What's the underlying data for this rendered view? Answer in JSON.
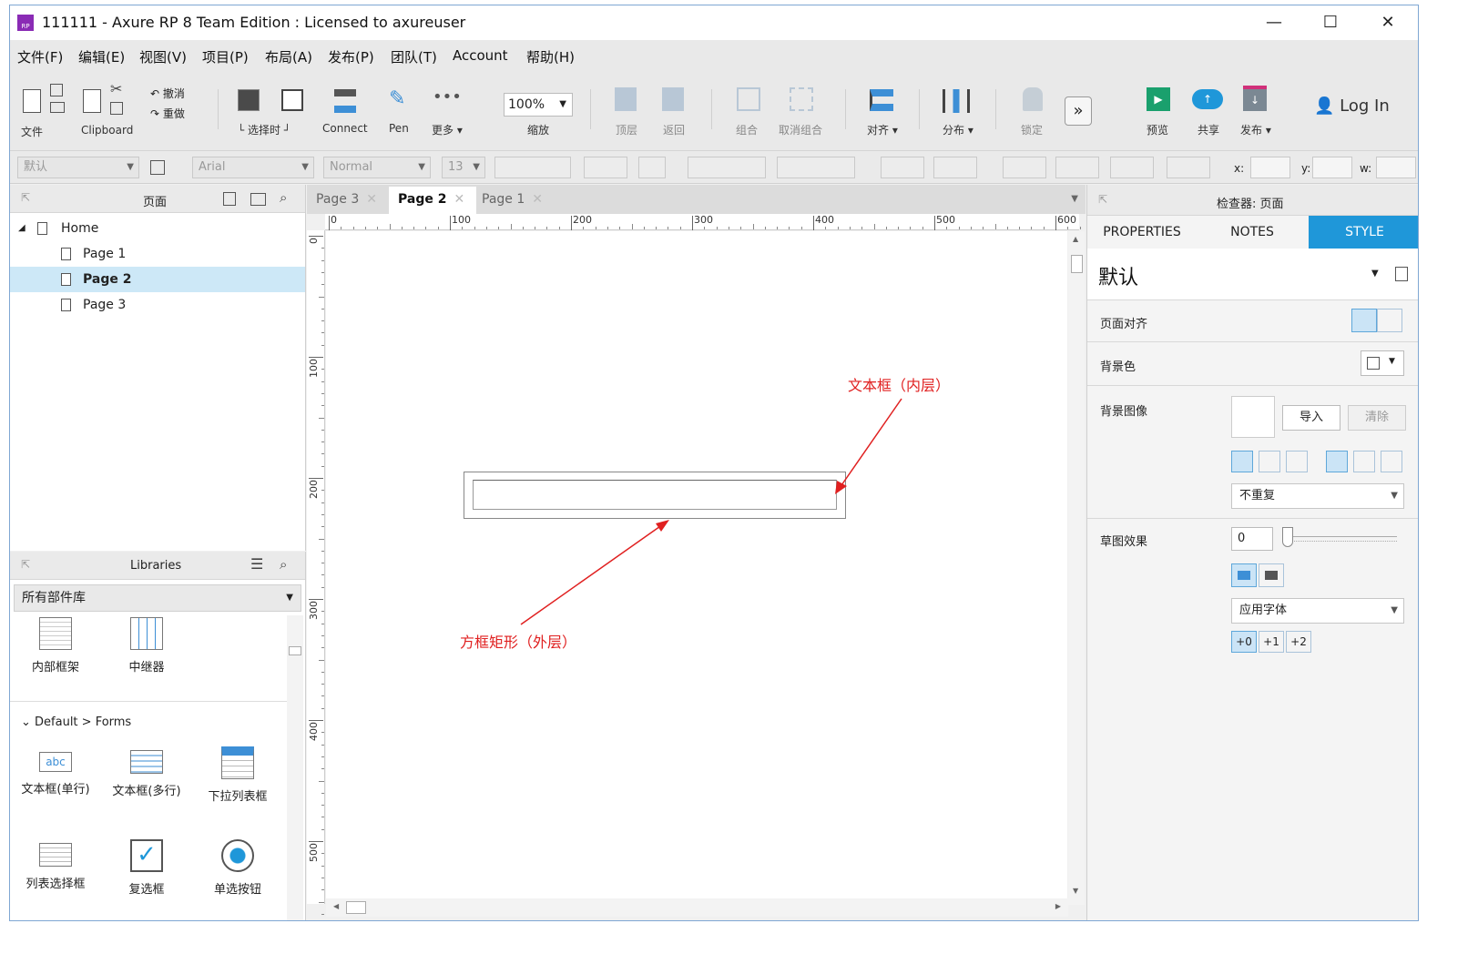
{
  "window": {
    "title": "111111 - Axure RP 8 Team Edition : Licensed to axureuser",
    "logo_text": "RP",
    "controls": {
      "minimize": "—",
      "maximize": "☐",
      "close": "✕"
    }
  },
  "menubar": [
    "文件(F)",
    "编辑(E)",
    "视图(V)",
    "项目(P)",
    "布局(A)",
    "发布(P)",
    "团队(T)",
    "Account",
    "帮助(H)"
  ],
  "toolbar": {
    "file_label": "文件",
    "clipboard_label": "Clipboard",
    "undo_label": "撤消",
    "redo_label": "重做",
    "select_label": "└ 选择时 ┘",
    "connect_label": "Connect",
    "pen_label": "Pen",
    "more_label": "更多 ▾",
    "zoom_value": "100%",
    "zoom_label": "缩放",
    "top_label": "顶层",
    "back_label": "返回",
    "group_label": "组合",
    "ungroup_label": "取消组合",
    "align_label": "对齐 ▾",
    "distribute_label": "分布 ▾",
    "lock_label": "锁定",
    "preview_label": "预览",
    "share_label": "共享",
    "publish_label": "发布 ▾",
    "login_label": "Log In"
  },
  "formatbar": {
    "style_value": "默认",
    "font_value": "Arial",
    "weight_value": "Normal",
    "size_value": "13",
    "x_label": "x:",
    "y_label": "y:",
    "w_label": "w:"
  },
  "pages_panel": {
    "title": "页面",
    "items": [
      {
        "label": "Home"
      },
      {
        "label": "Page 1"
      },
      {
        "label": "Page 2"
      },
      {
        "label": "Page 3"
      }
    ]
  },
  "libraries_panel": {
    "title": "Libraries",
    "dropdown": "所有部件库",
    "top_widgets": [
      "内部框架",
      "中继器"
    ],
    "section": "Default > Forms",
    "form_widgets": [
      "文本框(单行)",
      "文本框(多行)",
      "下拉列表框",
      "列表选择框",
      "复选框",
      "单选按钮"
    ]
  },
  "tabs": [
    {
      "label": "Page 3"
    },
    {
      "label": "Page 2"
    },
    {
      "label": "Page 1"
    }
  ],
  "ruler": {
    "h_ticks": [
      "0",
      "100",
      "200",
      "300",
      "400",
      "500",
      "600"
    ],
    "v_ticks": [
      "0",
      "100",
      "200",
      "300",
      "400",
      "500"
    ]
  },
  "canvas": {
    "annotation_inner": "文本框（内层）",
    "annotation_outer": "方框矩形（外层）"
  },
  "inspector": {
    "title": "检查器: 页面",
    "tabs": [
      "PROPERTIES",
      "NOTES",
      "STYLE"
    ],
    "style_name": "默认",
    "page_align_label": "页面对齐",
    "bg_color_label": "背景色",
    "bg_image_label": "背景图像",
    "import_label": "导入",
    "clear_label": "清除",
    "repeat_value": "不重复",
    "sketch_label": "草图效果",
    "sketch_value": "0",
    "font_value": "应用字体",
    "font_steps": [
      "+0",
      "+1",
      "+2"
    ]
  },
  "colors": {
    "accent": "#1f97d9",
    "annotation": "#e02020",
    "selected_row": "#cde8f7"
  }
}
